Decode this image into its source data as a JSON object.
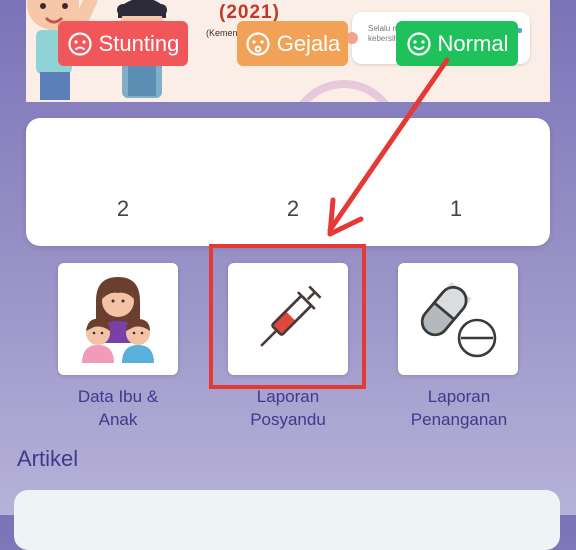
{
  "banner": {
    "year": "(2021)",
    "source": "(Kemenkes, 2022)",
    "tip_text": "Selalu menjaga kebersihan lingkungan"
  },
  "stats": [
    {
      "label": "Stunting",
      "count": "2",
      "color": "#f0565a",
      "icon": "sad-face-icon"
    },
    {
      "label": "Gejala",
      "count": "2",
      "color": "#f2a257",
      "icon": "worried-face-icon"
    },
    {
      "label": "Normal",
      "count": "1",
      "color": "#1fc15a",
      "icon": "smile-face-icon"
    }
  ],
  "menu": [
    {
      "label_line1": "Data Ibu &",
      "label_line2": "Anak",
      "icon": "mother-children-icon"
    },
    {
      "label_line1": "Laporan",
      "label_line2": "Posyandu",
      "icon": "syringe-icon"
    },
    {
      "label_line1": "Laporan",
      "label_line2": "Penanganan",
      "icon": "pills-icon"
    }
  ],
  "section": {
    "title": "Artikel"
  },
  "colors": {
    "accent_text": "#3f3a8a",
    "annotation_red": "#e53935"
  }
}
